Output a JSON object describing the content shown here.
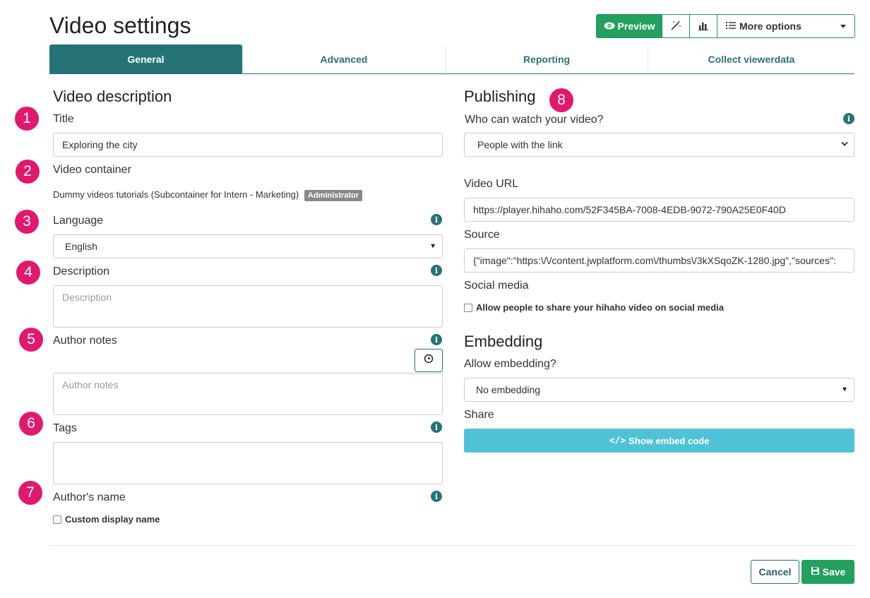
{
  "page": {
    "title": "Video settings"
  },
  "toolbar": {
    "preview_label": "Preview",
    "more_label": "More options",
    "icons": [
      "eye-icon",
      "magic-wand-icon",
      "bar-chart-icon",
      "list-icon",
      "caret-down-icon"
    ]
  },
  "tabs": [
    {
      "label": "General",
      "active": true
    },
    {
      "label": "Advanced",
      "active": false
    },
    {
      "label": "Reporting",
      "active": false
    },
    {
      "label": "Collect viewerdata",
      "active": false
    }
  ],
  "left": {
    "section_title": "Video description",
    "title_label": "Title",
    "title_value": "Exploring the city",
    "container_label": "Video container",
    "container_value": "Dummy videos tutorials (Subcontainer for Intern - Marketing)",
    "container_badge": "Administrator",
    "language_label": "Language",
    "language_value": "English",
    "description_label": "Description",
    "description_placeholder": "Description",
    "author_notes_label": "Author notes",
    "author_notes_placeholder": "Author notes",
    "tags_label": "Tags",
    "authors_name_label": "Author's name",
    "custom_display_name": "Custom display name"
  },
  "right": {
    "section_title": "Publishing",
    "who_label": "Who can watch your video?",
    "who_value": "People with the link",
    "video_url_label": "Video URL",
    "video_url_value": "https://player.hihaho.com/52F345BA-7008-4EDB-9072-790A25E0F40D",
    "source_label": "Source",
    "source_value": "{\"image\":\"https:\\/\\/content.jwplatform.com\\/thumbs\\/3kXSqoZK-1280.jpg\",\"sources\":",
    "social_label": "Social media",
    "social_checkbox": "Allow people to share your hihaho video on social media",
    "embedding_title": "Embedding",
    "allow_embedding_label": "Allow embedding?",
    "allow_embedding_value": "No embedding",
    "share_label": "Share",
    "show_embed_label": "Show embed code"
  },
  "annotations": [
    "1",
    "2",
    "3",
    "4",
    "5",
    "6",
    "7",
    "8"
  ],
  "footer": {
    "cancel_label": "Cancel",
    "save_label": "Save"
  },
  "colors": {
    "teal": "#267377",
    "green": "#21a060",
    "pink": "#e0196f",
    "cyan": "#4fc3d5"
  }
}
